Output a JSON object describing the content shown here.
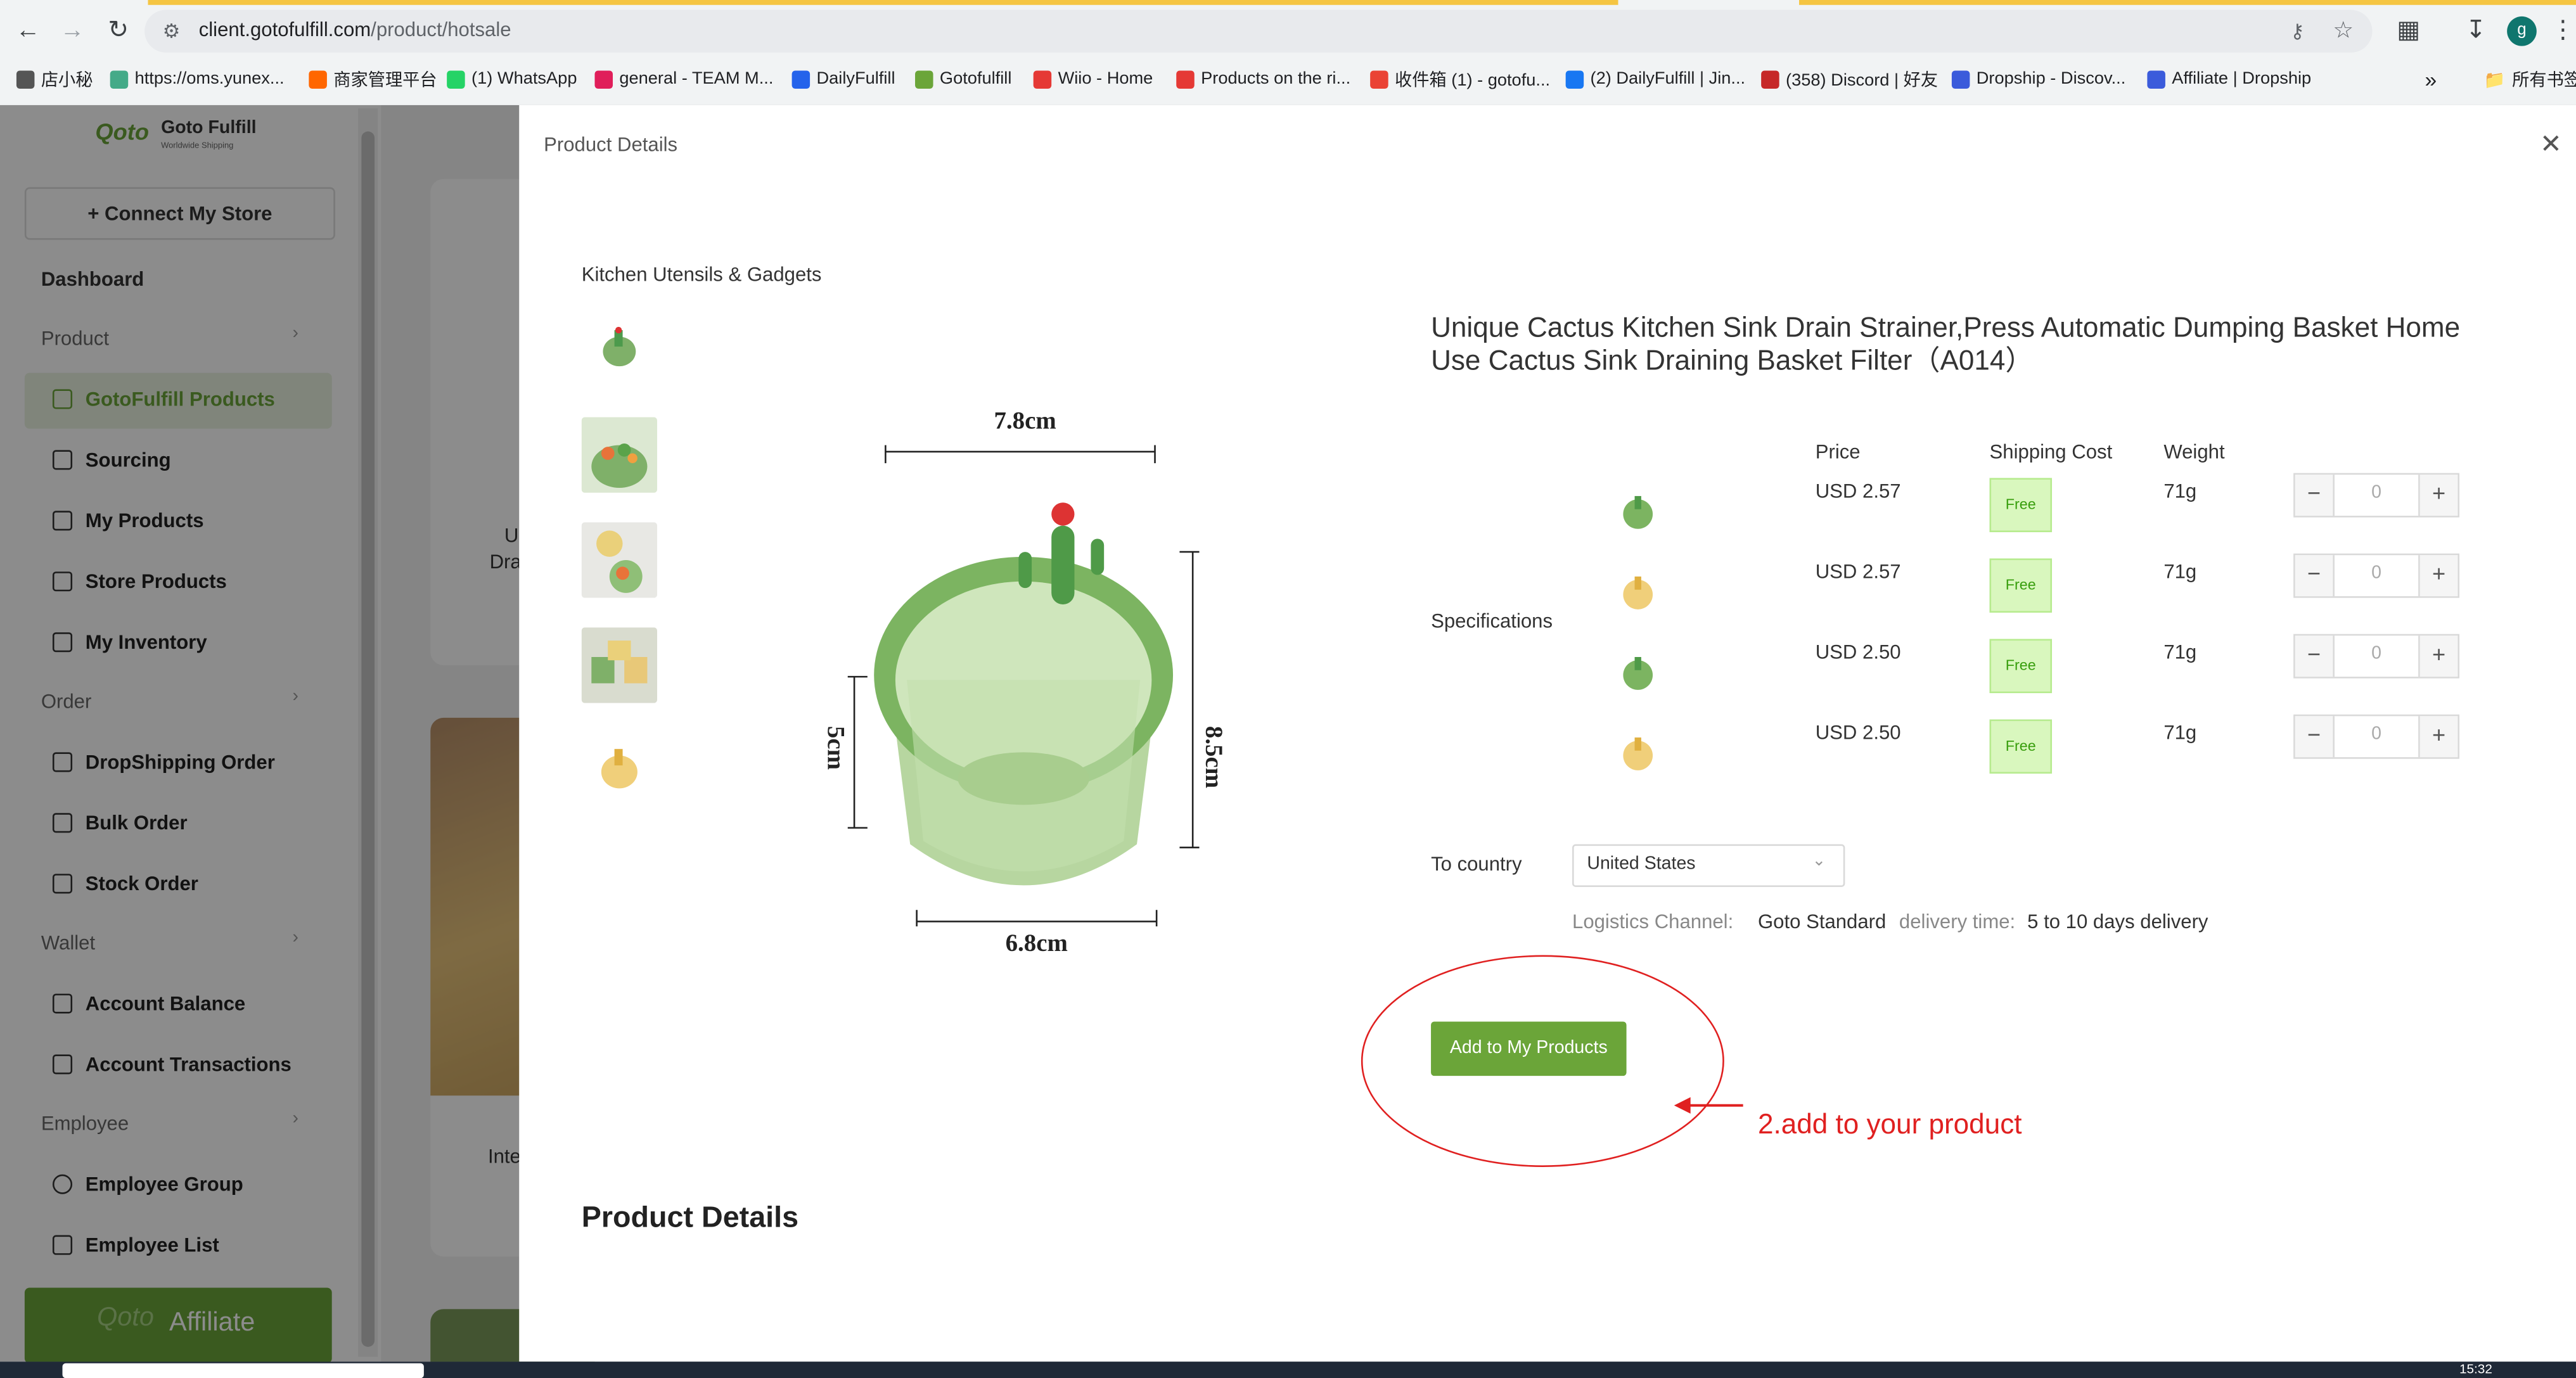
{
  "browser": {
    "url_domain": "client.gotofulfill.com",
    "url_path": "/product/hotsale",
    "bookmarks": [
      {
        "label": "店小秘",
        "icon": "folder-icon",
        "color": "#555"
      },
      {
        "label": "https://oms.yunex...",
        "icon": "link-icon",
        "color": "#4a8"
      },
      {
        "label": "商家管理平台",
        "icon": "shop-icon",
        "color": "#f60"
      },
      {
        "label": "(1) WhatsApp",
        "icon": "whatsapp-icon",
        "color": "#25d366"
      },
      {
        "label": "general - TEAM M...",
        "icon": "slack-icon",
        "color": "#e01e5a"
      },
      {
        "label": "DailyFulfill",
        "icon": "dailyfulfill-icon",
        "color": "#2563eb"
      },
      {
        "label": "Gotofulfill",
        "icon": "gotofulfill-icon",
        "color": "#6ba539"
      },
      {
        "label": "Wiio - Home",
        "icon": "wiio-icon",
        "color": "#e53935"
      },
      {
        "label": "Products on the ri...",
        "icon": "products-icon",
        "color": "#e53935"
      },
      {
        "label": "收件箱 (1) - gotofu...",
        "icon": "gmail-icon",
        "color": "#ea4335"
      },
      {
        "label": "(2) DailyFulfill | Jin...",
        "icon": "facebook-icon",
        "color": "#1877f2"
      },
      {
        "label": "(358) Discord | 好友",
        "icon": "discord-icon",
        "color": "#c62828"
      },
      {
        "label": "Dropship - Discov...",
        "icon": "dropship-icon",
        "color": "#3b5bdb"
      },
      {
        "label": "Affiliate | Dropship",
        "icon": "affiliate-icon",
        "color": "#3b5bdb"
      }
    ],
    "bookmarks_more": "»",
    "all_bookmarks": "所有书签",
    "profile_initial": "g"
  },
  "sidebar": {
    "logo_text": "Goto Fulfill",
    "logo_sub": "Worldwide Shipping",
    "connect_store": "+ Connect My Store",
    "dashboard": "Dashboard",
    "product_section": "Product",
    "order_section": "Order",
    "wallet_section": "Wallet",
    "employee_section": "Employee",
    "items": {
      "gotofulfill_products": "GotoFulfill Products",
      "sourcing": "Sourcing",
      "my_products": "My Products",
      "store_products": "Store Products",
      "my_inventory": "My Inventory",
      "dropshipping_order": "DropShipping Order",
      "bulk_order": "Bulk Order",
      "stock_order": "Stock Order",
      "account_balance": "Account Balance",
      "account_transactions": "Account Transactions",
      "employee_group": "Employee Group",
      "employee_list": "Employee List"
    },
    "affiliate": "Affiliate"
  },
  "background": {
    "card1_text": "U",
    "card1_text2": "Dra",
    "card2_text": "Inte"
  },
  "drawer": {
    "title": "Product Details",
    "category": "Kitchen Utensils & Gadgets",
    "image_dims": {
      "top": "7.8cm",
      "bottom": "6.8cm",
      "left": "5cm",
      "right": "8.5cm"
    },
    "product_title": "Unique Cactus Kitchen Sink Drain Strainer,Press Automatic Dumping Basket Home Use Cactus Sink Draining Basket Filter（A014）",
    "spec_label": "Specifications",
    "headers": {
      "price": "Price",
      "shipping": "Shipping Cost",
      "weight": "Weight"
    },
    "specs": [
      {
        "color": "green",
        "price": "USD 2.57",
        "shipping": "Free",
        "weight": "71g",
        "qty": "0"
      },
      {
        "color": "yellow",
        "price": "USD 2.57",
        "shipping": "Free",
        "weight": "71g",
        "qty": "0"
      },
      {
        "color": "green",
        "price": "USD 2.50",
        "shipping": "Free",
        "weight": "71g",
        "qty": "0"
      },
      {
        "color": "yellow",
        "price": "USD 2.50",
        "shipping": "Free",
        "weight": "71g",
        "qty": "0"
      }
    ],
    "to_country_label": "To country",
    "country": "United States",
    "logistics_label": "Logistics Channel:",
    "logistics_value": "Goto Standard",
    "delivery_label": "delivery time:",
    "delivery_value": "5 to 10 days delivery",
    "add_button": "Add to My Products",
    "annotation": "2.add to your product",
    "section_heading": "Product Details"
  },
  "taskbar": {
    "time": "15:32"
  },
  "colors": {
    "accent": "#6ba539",
    "annotation": "#e02020",
    "free_bg": "#d9f7be"
  }
}
